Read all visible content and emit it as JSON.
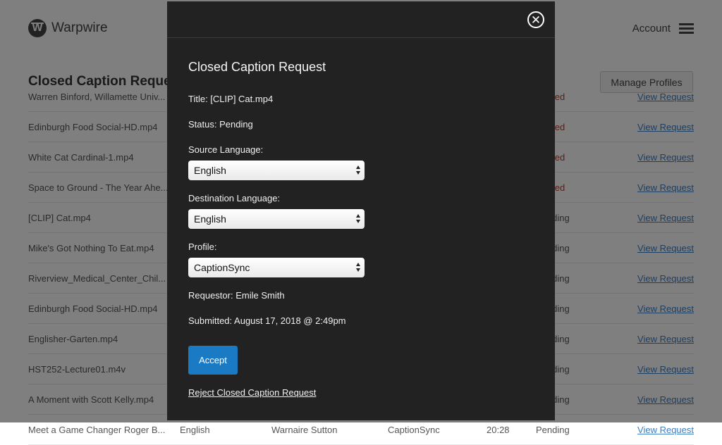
{
  "header": {
    "logo_text": "Warpwire",
    "logo_letter": "W",
    "account_label": "Account"
  },
  "page": {
    "title": "Closed Caption Requests",
    "manage_profiles_label": "Manage Profiles"
  },
  "rows": [
    {
      "name": "Warren Binford, Willamette Univ...",
      "status": "Denied",
      "status_type": "denied",
      "link": "View Request"
    },
    {
      "name": "Edinburgh Food Social-HD.mp4",
      "status": "Denied",
      "status_type": "denied",
      "link": "View Request"
    },
    {
      "name": "White Cat Cardinal-1.mp4",
      "status": "Denied",
      "status_type": "denied",
      "link": "View Request"
    },
    {
      "name": "Space to Ground - The Year Ahe...",
      "status": "Denied",
      "status_type": "denied",
      "link": "View Request"
    },
    {
      "name": "[CLIP] Cat.mp4",
      "status": "Pending",
      "status_type": "pending",
      "link": "View Request"
    },
    {
      "name": "Mike's Got Nothing To Eat.mp4",
      "status": "Pending",
      "status_type": "pending",
      "link": "View Request"
    },
    {
      "name": "Riverview_Medical_Center_Chil...",
      "status": "Pending",
      "status_type": "pending",
      "link": "View Request"
    },
    {
      "name": "Edinburgh Food Social-HD.mp4",
      "status": "Pending",
      "status_type": "pending",
      "link": "View Request"
    },
    {
      "name": "Englisher-Garten.mp4",
      "status": "Pending",
      "status_type": "pending",
      "link": "View Request"
    },
    {
      "name": "HST252-Lecture01.m4v",
      "status": "Pending",
      "status_type": "pending",
      "link": "View Request"
    },
    {
      "name": "A Moment with Scott Kelly.mp4",
      "status": "Pending",
      "status_type": "pending",
      "link": "View Request"
    },
    {
      "name": "Meet a Game Changer Roger B...",
      "source": "English",
      "requestor": "Warnaire Sutton",
      "profile": "CaptionSync",
      "duration": "20:28",
      "status": "Pending",
      "status_type": "pending",
      "link": "View Request"
    }
  ],
  "modal": {
    "title": "Closed Caption Request",
    "title_line": "Title: [CLIP] Cat.mp4",
    "status_line": "Status: Pending",
    "source_label": "Source Language:",
    "source_value": "English",
    "destination_label": "Destination Language:",
    "destination_value": "English",
    "profile_label": "Profile:",
    "profile_value": "CaptionSync",
    "requestor_line": "Requestor: Emile Smith",
    "submitted_line": "Submitted: August 17, 2018 @ 2:49pm",
    "accept_label": "Accept",
    "reject_label": "Reject Closed Caption Request",
    "close_icon": "close-circle-icon"
  },
  "colors": {
    "accent": "#1a7bc4",
    "modal_bg": "#222222",
    "denied": "#c0392b",
    "link": "#3b7fc4"
  }
}
